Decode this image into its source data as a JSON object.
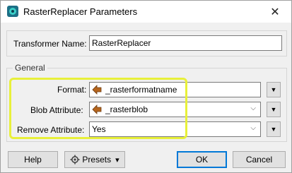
{
  "window": {
    "title": "RasterReplacer Parameters",
    "close_glyph": "✕"
  },
  "transformer": {
    "label": "Transformer Name:",
    "value": "RasterReplacer"
  },
  "general": {
    "title": "General",
    "fields": [
      {
        "label": "Format:",
        "value": "_rasterformatname",
        "icon": "attribute-icon"
      },
      {
        "label": "Blob Attribute:",
        "value": "_rasterblob",
        "icon": "attribute-icon"
      },
      {
        "label": "Remove Attribute:",
        "value": "Yes"
      }
    ],
    "menu_glyph": "▼",
    "combo_glyph": "⌵"
  },
  "footer": {
    "help": "Help",
    "presets": "Presets",
    "presets_arrow": "▾",
    "ok": "OK",
    "cancel": "Cancel"
  },
  "colors": {
    "highlight": "#e8f03a",
    "attr_icon": "#b5651d"
  }
}
